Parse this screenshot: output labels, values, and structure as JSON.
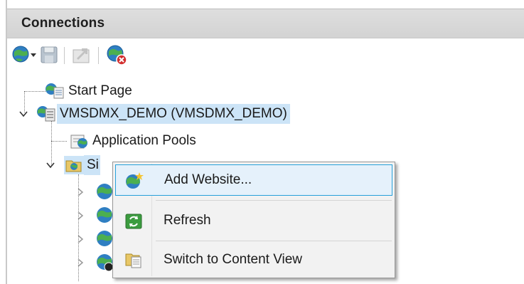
{
  "panel": {
    "title": "Connections"
  },
  "toolbar": {
    "items": [
      {
        "icon": "globe-connect-dropdown-icon"
      },
      {
        "icon": "save-icon"
      },
      {
        "icon": "up-level-icon"
      },
      {
        "icon": "delete-connection-icon"
      }
    ]
  },
  "tree": {
    "start_page": "Start Page",
    "server": "VMSDMX_DEMO (VMSDMX_DEMO)",
    "app_pools": "Application Pools",
    "sites": "Si"
  },
  "context_menu": {
    "items": [
      {
        "label": "Add Website...",
        "icon": "add-website-icon",
        "highlighted": true
      },
      {
        "label": "Refresh",
        "icon": "refresh-icon",
        "highlighted": false
      },
      {
        "label": "Switch to Content View",
        "icon": "content-view-icon",
        "highlighted": false
      }
    ]
  },
  "colors": {
    "selection": "#cce4f7",
    "menu_highlight_border": "#26a0da",
    "menu_highlight_fill": "#e5f1fb",
    "header_bg": "#d9d9d9"
  }
}
